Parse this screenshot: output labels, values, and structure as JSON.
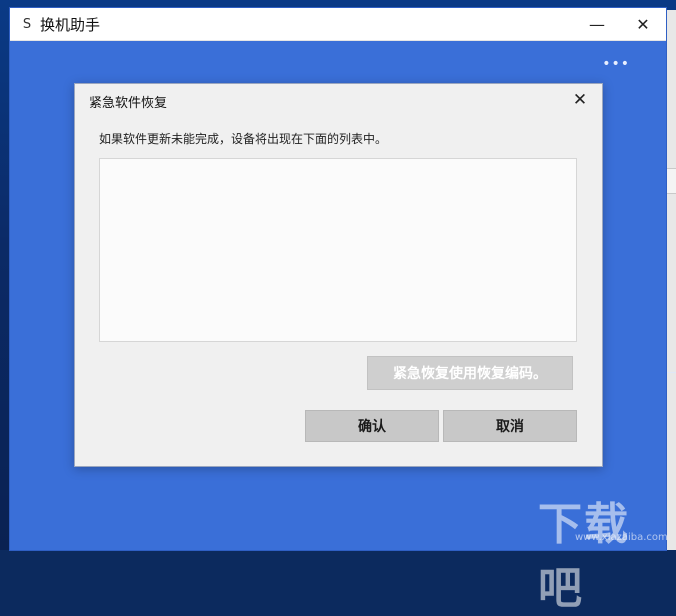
{
  "window": {
    "title": "换机助手",
    "icon_glyph": "S",
    "minimize_glyph": "—",
    "close_glyph": "✕",
    "more_glyph": "•••"
  },
  "dialog": {
    "title": "紧急软件恢复",
    "close_glyph": "✕",
    "description": "如果软件更新未能完成，设备将出现在下面的列表中。",
    "device_list_items": [],
    "recover_code_button": "紧急恢复使用恢复编码。",
    "confirm_button": "确认",
    "cancel_button": "取消"
  },
  "watermark": {
    "text": "下载吧",
    "url": "www.xiazaiba.com"
  },
  "colors": {
    "app_background": "#3a6fd8",
    "dialog_background": "#f0f0f0",
    "button_gray": "#c8c8c8"
  }
}
